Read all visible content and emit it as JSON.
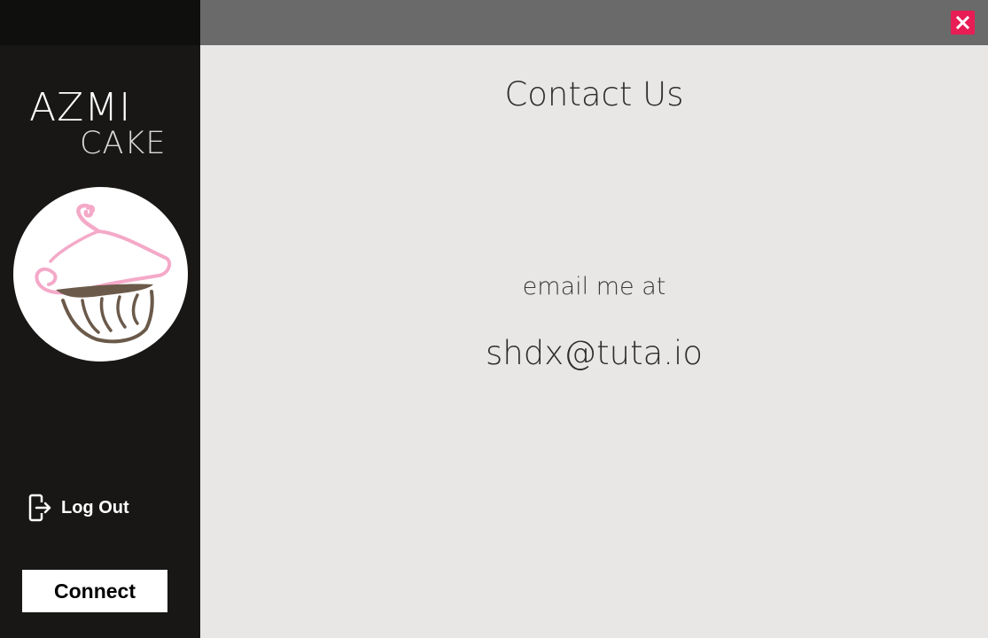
{
  "window": {
    "close_icon": "close-icon",
    "close_color": "#e81d55"
  },
  "sidebar": {
    "brand_line1": "AZMI",
    "brand_line2": "CAKE",
    "logo_icon": "cupcake-logo",
    "logout_label": "Log Out",
    "logout_icon": "logout-icon",
    "connect_label": "Connect"
  },
  "main": {
    "title": "Contact Us",
    "email_label": "email me at",
    "email": "shdx@tuta.io"
  },
  "colors": {
    "sidebar_bg": "#181716",
    "topbar_bg": "#6a6a6a",
    "content_bg": "#e8e7e6",
    "logo_pink": "#f4a9c8",
    "logo_brown": "#6b5a4a"
  }
}
